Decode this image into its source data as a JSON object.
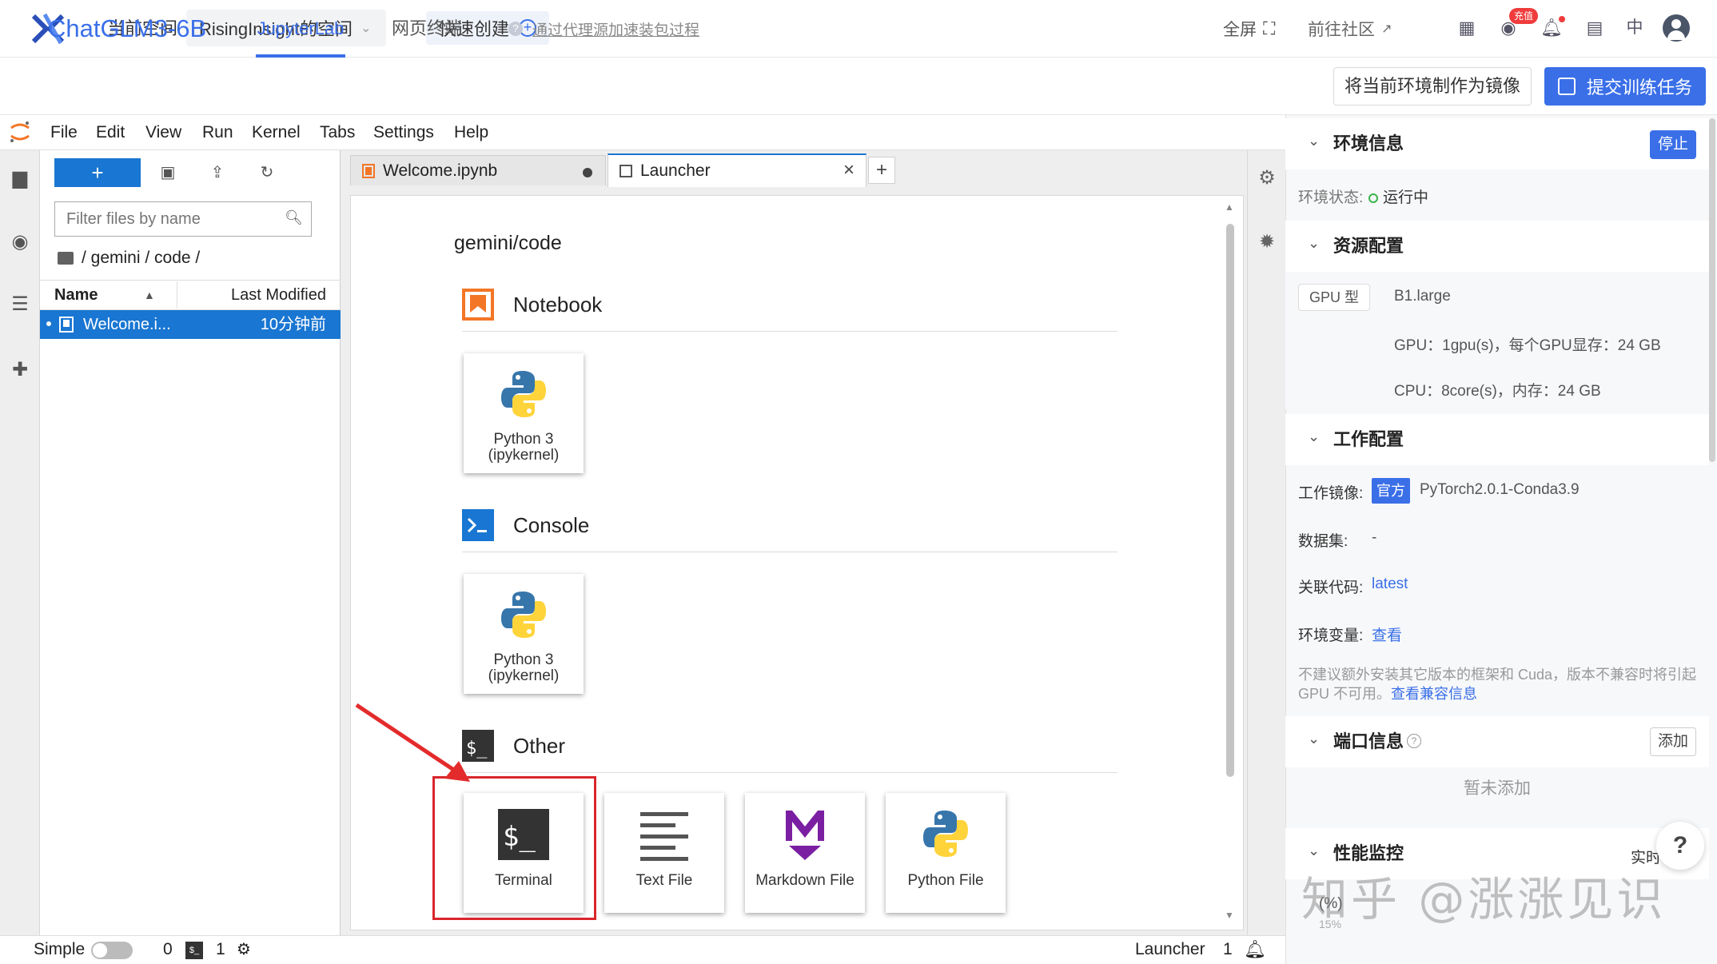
{
  "topbar": {
    "current_space_label": "当前空间",
    "space_name": "RisingInsight的空间",
    "quick_create": "快速创建",
    "community": "前往社区",
    "recharge_badge": "充值",
    "lang": "中"
  },
  "projectbar": {
    "title": "ChatGLM3-6B",
    "tabs": [
      {
        "label": "JupyterLab",
        "active": true
      },
      {
        "label": "网页终端",
        "active": false
      }
    ],
    "proxy_link": "通过代理源加速装包过程",
    "fullscreen": "全屏",
    "make_image": "将当前环境制作为镜像",
    "submit_task": "提交训练任务"
  },
  "jupyter_menu": [
    "File",
    "Edit",
    "View",
    "Run",
    "Kernel",
    "Tabs",
    "Settings",
    "Help"
  ],
  "filebrowser": {
    "new_label": "+",
    "filter_placeholder": "Filter files by name",
    "breadcrumb": "/ gemini / code /",
    "col_name": "Name",
    "col_modified": "Last Modified",
    "files": [
      {
        "name": "Welcome.i...",
        "modified": "10分钟前",
        "selected": true
      }
    ]
  },
  "doc_tabs": [
    {
      "label": "Welcome.ipynb",
      "active": false
    },
    {
      "label": "Launcher",
      "active": true
    }
  ],
  "launcher": {
    "path": "gemini/code",
    "sections": {
      "notebook": "Notebook",
      "console": "Console",
      "other": "Other"
    },
    "notebook_kernel": "Python 3\n(ipykernel)",
    "console_kernel": "Python 3\n(ipykernel)",
    "other_items": [
      "Terminal",
      "Text File",
      "Markdown File",
      "Python File"
    ]
  },
  "statusbar": {
    "mode": "Simple",
    "count_a": "0",
    "count_b": "1",
    "current": "Launcher",
    "count_c": "1"
  },
  "rightpanel": {
    "env_info": {
      "title": "环境信息",
      "stop": "停止",
      "status_label": "环境状态:",
      "status_value": "运行中"
    },
    "resource": {
      "title": "资源配置",
      "gpu_type_tag": "GPU 型",
      "instance": "B1.large",
      "gpu_line": "GPU：1gpu(s)，每个GPU显存：24 GB",
      "cpu_line": "CPU：8core(s)，内存：24 GB"
    },
    "work": {
      "title": "工作配置",
      "image_label": "工作镜像:",
      "official_tag": "官方",
      "image_value": "PyTorch2.0.1-Conda3.9",
      "dataset_label": "数据集:",
      "dataset_value": "-",
      "code_label": "关联代码:",
      "code_value": "latest",
      "envvar_label": "环境变量:",
      "envvar_value": "查看",
      "warning": "不建议额外安装其它版本的框架和 Cuda，版本不兼容时将引起",
      "warning2": "GPU 不可用。",
      "warning_link": "查看兼容信息"
    },
    "ports": {
      "title": "端口信息",
      "add": "添加",
      "empty": "暂未添加"
    },
    "perf": {
      "title": "性能监控",
      "realtime": "实时",
      "metric": "(%)",
      "tick": "15%"
    },
    "help": "?",
    "watermark": "知乎 @涨涨见识"
  },
  "colors": {
    "accent": "#3a6fe8",
    "jupyter_blue": "#1976d2",
    "jupyter_orange": "#f37626",
    "highlight_red": "#d9262c"
  }
}
